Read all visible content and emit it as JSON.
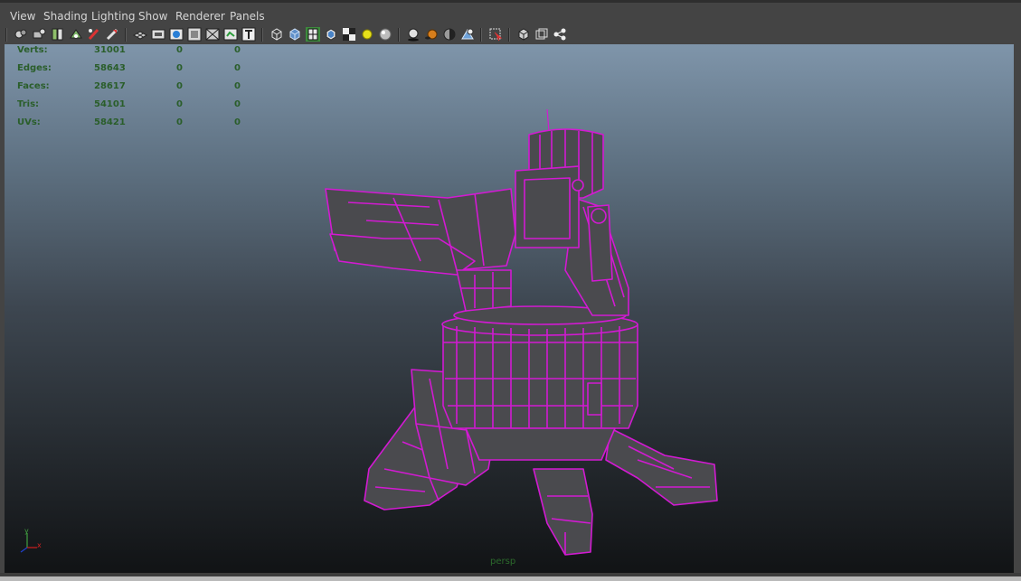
{
  "menu": {
    "view": "View",
    "shading": "Shading",
    "lighting": "Lighting",
    "show": "Show",
    "renderer": "Renderer",
    "panels": "Panels"
  },
  "toolbar_icons": [
    "camera-attributes-icon",
    "camera-bookmark-icon",
    "image-plane-icon",
    "2d-pan-zoom-icon",
    "grease-pencil-icon",
    "camera-tools-icon",
    "grid-icon",
    "film-gate-icon",
    "resolution-gate-icon",
    "gate-mask-icon",
    "field-chart-icon",
    "safe-title-icon",
    "wireframe-icon",
    "smooth-shade-icon",
    "wireframe-on-shaded-icon",
    "textured-icon",
    "default-material-icon",
    "use-default-lighting-icon",
    "all-lights-icon",
    "shadows-icon",
    "screen-space-ao-icon",
    "motion-blur-icon",
    "isolate-select-icon",
    "xray-icon",
    "xray-active-components-icon",
    "xray-joints-icon"
  ],
  "hud": {
    "rows": [
      {
        "label": "Verts:",
        "v1": "31001",
        "v2": "0",
        "v3": "0"
      },
      {
        "label": "Edges:",
        "v1": "58643",
        "v2": "0",
        "v3": "0"
      },
      {
        "label": "Faces:",
        "v1": "28617",
        "v2": "0",
        "v3": "0"
      },
      {
        "label": "Tris:",
        "v1": "54101",
        "v2": "0",
        "v3": "0"
      },
      {
        "label": "UVs:",
        "v1": "58421",
        "v2": "0",
        "v3": "0"
      }
    ]
  },
  "camera_label": "persp",
  "axis": {
    "x": "x",
    "y": "y"
  },
  "colors": {
    "wireframe": "#d21ad2",
    "hud_text": "#2a5e2a",
    "menu_text": "#d6d6d6"
  }
}
